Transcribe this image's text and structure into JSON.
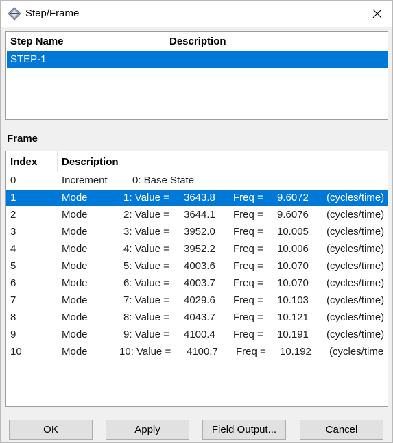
{
  "window": {
    "title": "Step/Frame"
  },
  "step_table": {
    "headers": [
      "Step Name",
      "Description"
    ],
    "rows": [
      {
        "name": "STEP-1",
        "description": ""
      }
    ]
  },
  "frame_section": {
    "label": "Frame",
    "headers": [
      "Index",
      "Description"
    ],
    "rows": [
      {
        "index": "0",
        "type": "Increment",
        "desc": "0: Base State",
        "value_num": "",
        "freq_label": "",
        "freq_num": "",
        "unit": ""
      },
      {
        "index": "1",
        "type": "Mode",
        "desc": "1: Value =",
        "value_num": "3643.8",
        "freq_label": "Freq =",
        "freq_num": "9.6072",
        "unit": "(cycles/time)"
      },
      {
        "index": "2",
        "type": "Mode",
        "desc": "2: Value =",
        "value_num": "3644.1",
        "freq_label": "Freq =",
        "freq_num": "9.6076",
        "unit": "(cycles/time)"
      },
      {
        "index": "3",
        "type": "Mode",
        "desc": "3: Value =",
        "value_num": "3952.0",
        "freq_label": "Freq =",
        "freq_num": "10.005",
        "unit": "(cycles/time)"
      },
      {
        "index": "4",
        "type": "Mode",
        "desc": "4: Value =",
        "value_num": "3952.2",
        "freq_label": "Freq =",
        "freq_num": "10.006",
        "unit": "(cycles/time)"
      },
      {
        "index": "5",
        "type": "Mode",
        "desc": "5: Value =",
        "value_num": "4003.6",
        "freq_label": "Freq =",
        "freq_num": "10.070",
        "unit": "(cycles/time)"
      },
      {
        "index": "6",
        "type": "Mode",
        "desc": "6: Value =",
        "value_num": "4003.7",
        "freq_label": "Freq =",
        "freq_num": "10.070",
        "unit": "(cycles/time)"
      },
      {
        "index": "7",
        "type": "Mode",
        "desc": "7: Value =",
        "value_num": "4029.6",
        "freq_label": "Freq =",
        "freq_num": "10.103",
        "unit": "(cycles/time)"
      },
      {
        "index": "8",
        "type": "Mode",
        "desc": "8: Value =",
        "value_num": "4043.7",
        "freq_label": "Freq =",
        "freq_num": "10.121",
        "unit": "(cycles/time)"
      },
      {
        "index": "9",
        "type": "Mode",
        "desc": "9: Value =",
        "value_num": "4100.4",
        "freq_label": "Freq =",
        "freq_num": "10.191",
        "unit": "(cycles/time)"
      },
      {
        "index": "10",
        "type": "Mode",
        "desc": "10: Value =",
        "value_num": "4100.7",
        "freq_label": "Freq =",
        "freq_num": "10.192",
        "unit": "(cycles/time"
      }
    ]
  },
  "buttons": {
    "ok": "OK",
    "apply": "Apply",
    "field_output": "Field Output...",
    "cancel": "Cancel"
  },
  "colors": {
    "selection": "#0078d7",
    "window_bg": "#f0f0f0",
    "button_bg": "#e1e1e1"
  }
}
